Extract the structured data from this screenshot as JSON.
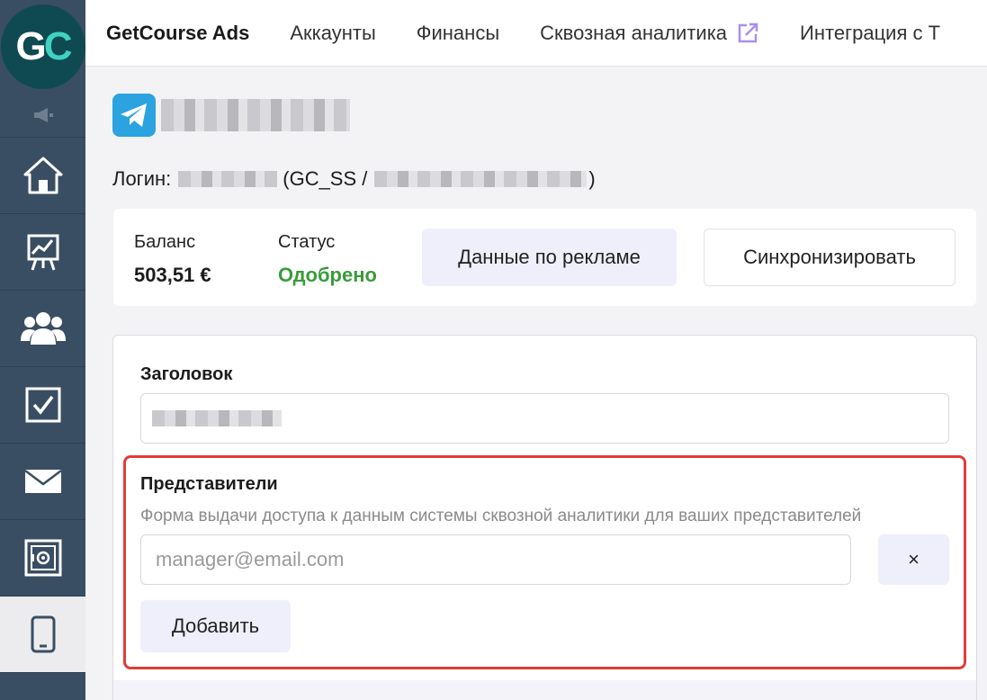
{
  "sidebar": {
    "logo": {
      "g": "G",
      "c": "C"
    },
    "items": [
      {
        "icon": "megaphone-icon"
      },
      {
        "icon": "home-icon"
      },
      {
        "icon": "chart-board-icon"
      },
      {
        "icon": "users-icon"
      },
      {
        "icon": "checkbox-icon"
      },
      {
        "icon": "mail-icon"
      },
      {
        "icon": "safe-icon"
      },
      {
        "icon": "mobile-phone-icon",
        "active": true
      }
    ]
  },
  "topnav": {
    "brand": "GetCourse Ads",
    "items": [
      {
        "label": "Аккаунты"
      },
      {
        "label": "Финансы"
      },
      {
        "label": "Сквозная аналитика",
        "external_icon": "external-link-icon"
      },
      {
        "label": "Интеграция с Т"
      }
    ]
  },
  "account": {
    "login_prefix": "Логин:",
    "login_mid": "(GC_SS /",
    "login_suffix": ")"
  },
  "summary": {
    "balance_label": "Баланс",
    "balance_value": "503,51 €",
    "status_label": "Статус",
    "status_value": "Одобрено",
    "ads_data_button": "Данные по рекламе",
    "sync_button": "Синхронизировать"
  },
  "form": {
    "title_label": "Заголовок",
    "representatives_label": "Представители",
    "representatives_desc": "Форма выдачи доступа к данным системы сквозной аналитики для ваших представителей",
    "email_placeholder": "manager@email.com",
    "remove_button": "×",
    "add_button": "Добавить"
  },
  "colors": {
    "sidebar": "#3a4e63",
    "status_green": "#3a9b3a",
    "highlight_red": "#e23b3b",
    "button_light": "#efeefb",
    "telegram_blue": "#2aa3e0"
  }
}
